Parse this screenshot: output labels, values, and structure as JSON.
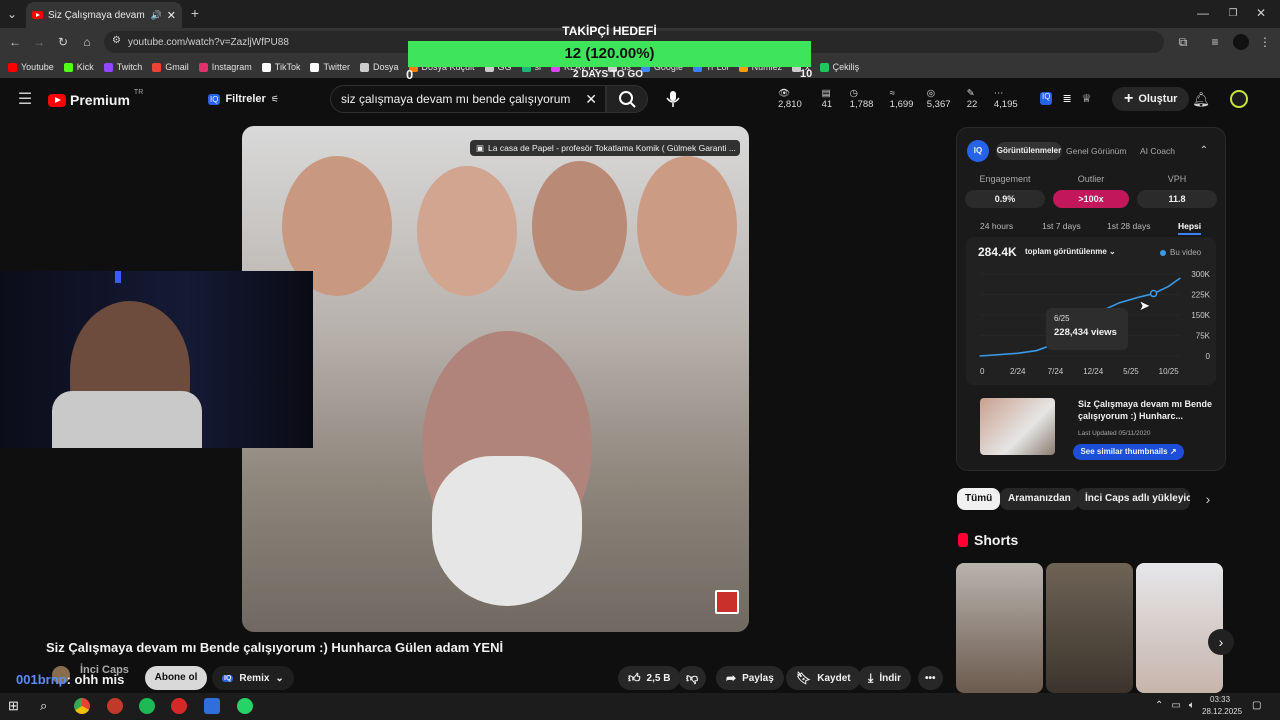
{
  "browser": {
    "tab_title": "Siz Çalışmaya devam mı Be",
    "url": "youtube.com/watch?v=ZazljWfPU88",
    "bookmarks": [
      {
        "label": "Youtube",
        "color": "#ff0000"
      },
      {
        "label": "Kick",
        "color": "#53fc18"
      },
      {
        "label": "Twitch",
        "color": "#9146ff"
      },
      {
        "label": "Gmail",
        "color": "#ea4335"
      },
      {
        "label": "Instagram",
        "color": "#e1306c"
      },
      {
        "label": "TikTok",
        "color": "#ffffff"
      },
      {
        "label": "Twitter",
        "color": "#ffffff"
      },
      {
        "label": "Dosya",
        "color": "#cccccc"
      },
      {
        "label": "Dosya Küçült",
        "color": "#ff7b00"
      },
      {
        "label": "GG",
        "color": "#cccccc"
      },
      {
        "label": "sl",
        "color": "#17b978"
      },
      {
        "label": "KLAVYE",
        "color": "#d946ef"
      },
      {
        "label": "ds",
        "color": "#cccccc"
      },
      {
        "label": "Google",
        "color": "#4285f4"
      },
      {
        "label": "Tr Lol",
        "color": "#3b82f6"
      },
      {
        "label": "Numiez",
        "color": "#f59e0b"
      },
      {
        "label": "x",
        "color": "#cccccc"
      },
      {
        "label": "Çekiliş",
        "color": "#22c55e"
      }
    ]
  },
  "goal": {
    "title": "TAKİPÇİ HEDEFİ",
    "progress_text": "12 (120.00%)",
    "min": "0",
    "days": "2 DAYS TO GO",
    "max": "10",
    "progress_fraction": 1.0,
    "color": "#3ee45a"
  },
  "header": {
    "logo_text": "Premium",
    "logo_region": "TR",
    "filters_label": "Filtreler",
    "search_query": "siz çalışmaya devam mı bende çalışıyorum",
    "stats": [
      "2,810",
      "41",
      "1,788",
      "1,699",
      "5,367",
      "22",
      "4,195"
    ],
    "create_label": "Oluştur"
  },
  "video": {
    "overlay_title": "La casa de Papel - profesör Tokatlama Komik ( Gülmek Garanti ...",
    "title": "Siz Çalışmaya devam mı Bende çalışıyorum :) Hunharca Gülen adam YENİ",
    "channel": "İnci Caps",
    "subscribe_label": "Abone ol",
    "remix_label": "Remix",
    "like_count": "2,5 B",
    "share_label": "Paylaş",
    "save_label": "Kaydet",
    "download_label": "İndir"
  },
  "chat": {
    "user": "001brnp",
    "message": ": ohh mis"
  },
  "iq_panel": {
    "tabs": [
      "Görüntülenmeler",
      "Genel Görünüm",
      "AI Coach"
    ],
    "metrics": [
      {
        "label": "Engagement",
        "value": "0.9%",
        "highlight": false
      },
      {
        "label": "Outlier",
        "value": ">100x",
        "highlight": true
      },
      {
        "label": "VPH",
        "value": "11.8",
        "highlight": false
      }
    ],
    "ranges": [
      "24 hours",
      "1st 7 days",
      "1st 28 days",
      "Hepsi"
    ],
    "active_range": "Hepsi",
    "total": "284.4K",
    "metric_select": "toplam görüntülenme",
    "legend": "Bu video",
    "tooltip_date": "6/25",
    "tooltip_value": "228,434 views",
    "similar_title": "Siz Çalışmaya devam mı Bende çalışıyorum :) Hunharc...",
    "last_updated": "Last Updated 05/11/2020",
    "similar_button": "See similar thumbnails"
  },
  "chart_data": {
    "type": "line",
    "title": "",
    "xlabel": "",
    "ylabel": "",
    "x_ticks": [
      "0",
      "2/24",
      "7/24",
      "12/24",
      "5/25",
      "10/25"
    ],
    "y_ticks": [
      "0",
      "75K",
      "150K",
      "225K",
      "300K"
    ],
    "ylim": [
      0,
      300000
    ],
    "series": [
      {
        "name": "Bu video",
        "x": [
          0,
          0.5,
          1,
          1.5,
          2,
          2.5,
          3,
          3.3,
          3.7,
          4.2,
          4.6,
          5,
          5.3
        ],
        "y": [
          0,
          5000,
          10000,
          20000,
          45000,
          100000,
          140000,
          170000,
          195000,
          215000,
          228434,
          255000,
          284400
        ]
      }
    ],
    "x_positions": [
      0,
      1,
      2,
      3,
      4,
      5
    ],
    "legend_position": "top-right"
  },
  "chips": [
    "Tümü",
    "Aramanızdan",
    "İnci Caps adlı yükleyicid"
  ],
  "shorts_heading": "Shorts",
  "taskbar": {
    "time": "03:33",
    "date": "28.12.2025"
  }
}
